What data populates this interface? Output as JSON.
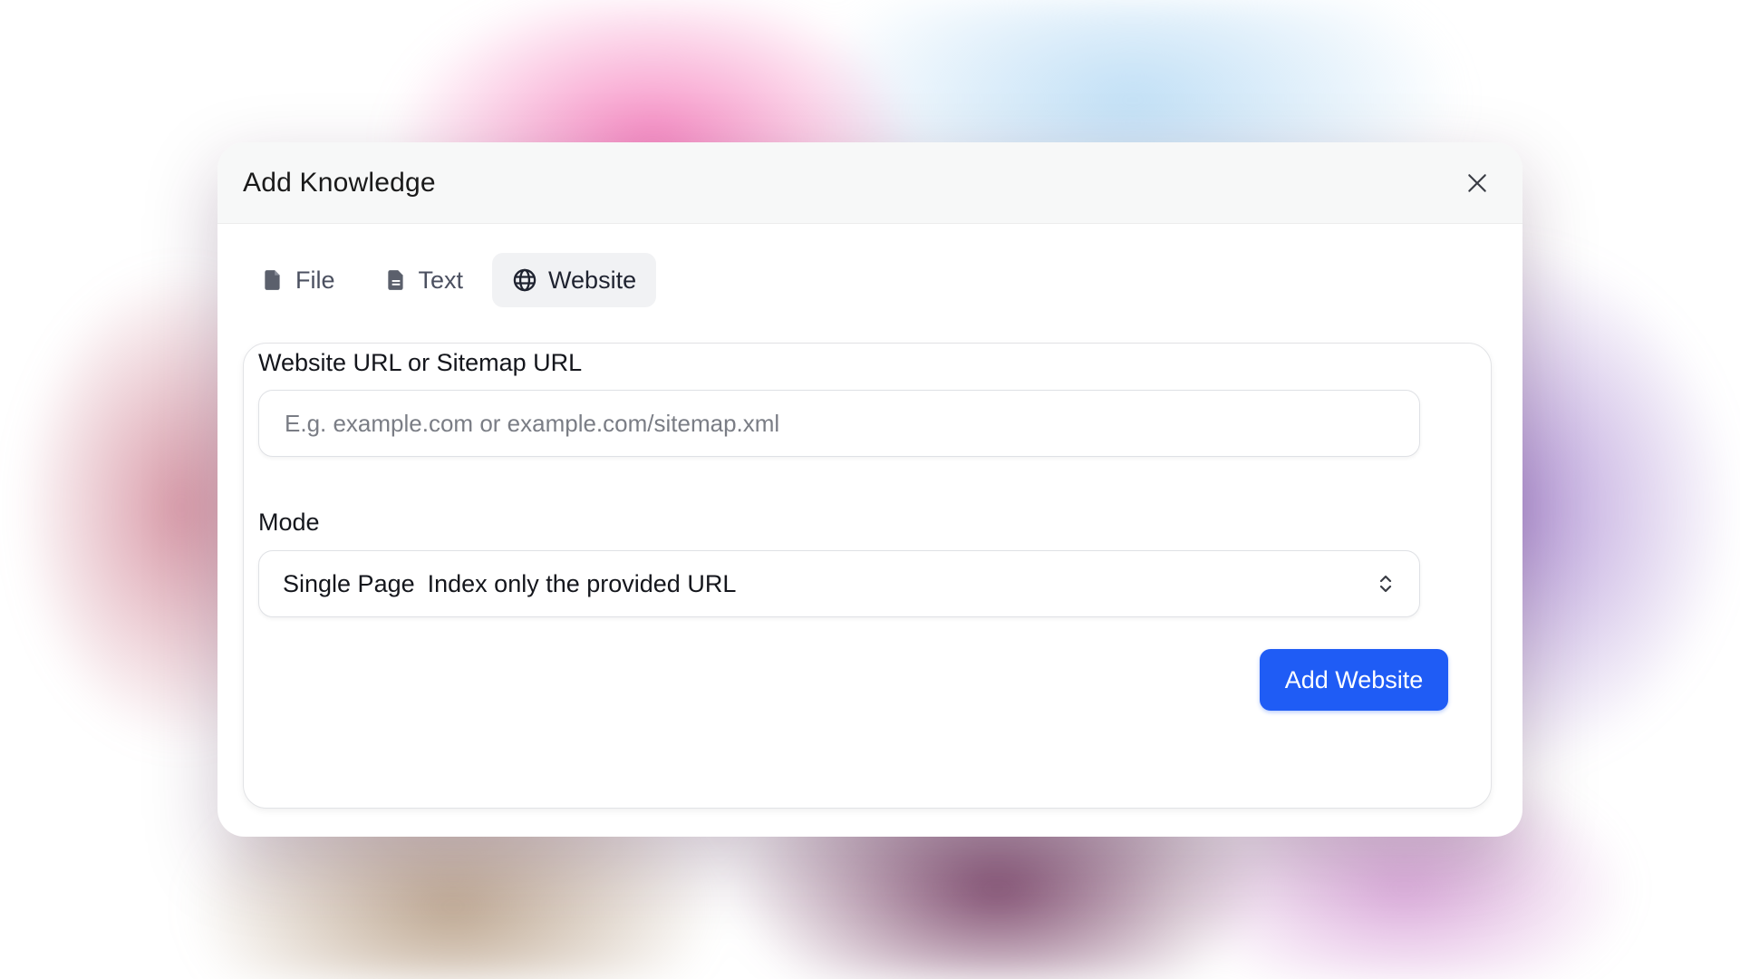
{
  "dialog": {
    "title": "Add Knowledge",
    "close_icon": "close-icon"
  },
  "tabs": [
    {
      "label": "File",
      "icon": "file-icon",
      "active": false
    },
    {
      "label": "Text",
      "icon": "document-text-icon",
      "active": false
    },
    {
      "label": "Website",
      "icon": "globe-icon",
      "active": true
    }
  ],
  "form": {
    "url_label": "Website URL or Sitemap URL",
    "url_placeholder": "E.g. example.com or example.com/sitemap.xml",
    "url_value": "",
    "mode_label": "Mode",
    "mode_selected": "Single Page",
    "mode_description": "Index only the provided URL",
    "submit_label": "Add Website"
  },
  "colors": {
    "accent": "#1f5cf5",
    "tab_active_bg": "#f1f2f4",
    "header_bg": "#f7f8f8"
  }
}
